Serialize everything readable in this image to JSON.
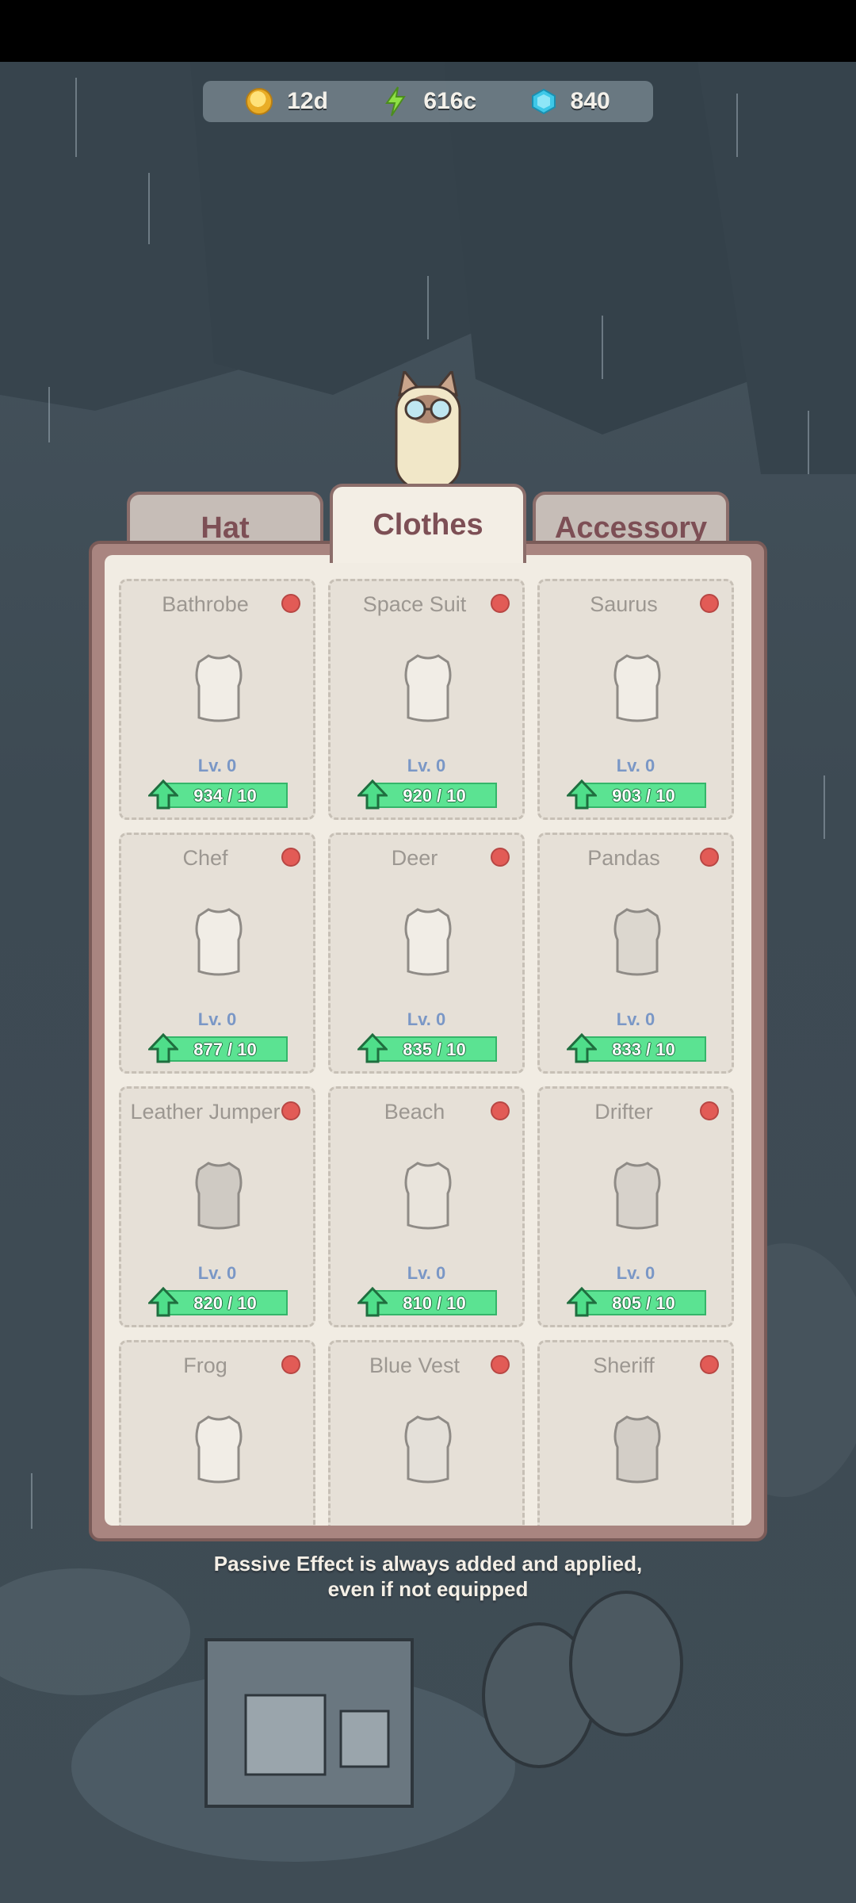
{
  "currency": {
    "coins": "12d",
    "energy": "616c",
    "gems": "840"
  },
  "tabs": [
    {
      "label": "Hat",
      "active": false
    },
    {
      "label": "Clothes",
      "active": true
    },
    {
      "label": "Accessory",
      "active": false
    }
  ],
  "items": [
    {
      "name": "Bathrobe",
      "level": "Lv. 0",
      "progress": "934 / 10",
      "icon": "bathrobe-icon",
      "shade": "#f1ede6"
    },
    {
      "name": "Space Suit",
      "level": "Lv. 0",
      "progress": "920 / 10",
      "icon": "space-suit-icon",
      "shade": "#f1ede6"
    },
    {
      "name": "Saurus",
      "level": "Lv. 0",
      "progress": "903 / 10",
      "icon": "saurus-vest-icon",
      "shade": "#f1ede6"
    },
    {
      "name": "Chef",
      "level": "Lv. 0",
      "progress": "877 / 10",
      "icon": "chef-coat-icon",
      "shade": "#f1ede6"
    },
    {
      "name": "Deer",
      "level": "Lv. 0",
      "progress": "835 / 10",
      "icon": "deer-vest-icon",
      "shade": "#f1ede6"
    },
    {
      "name": "Pandas",
      "level": "Lv. 0",
      "progress": "833 / 10",
      "icon": "pandas-vest-icon",
      "shade": "#dcd7cf"
    },
    {
      "name": "Leather Jumper",
      "level": "Lv. 0",
      "progress": "820 / 10",
      "icon": "leather-jumper-icon",
      "shade": "#cfcac3"
    },
    {
      "name": "Beach",
      "level": "Lv. 0",
      "progress": "810 / 10",
      "icon": "beach-shirt-icon",
      "shade": "#e9e4dc"
    },
    {
      "name": "Drifter",
      "level": "Lv. 0",
      "progress": "805 / 10",
      "icon": "drifter-vest-icon",
      "shade": "#d7d2cb"
    },
    {
      "name": "Frog",
      "level": "",
      "progress": "",
      "icon": "frog-vest-icon",
      "shade": "#f1ede6"
    },
    {
      "name": "Blue Vest",
      "level": "",
      "progress": "",
      "icon": "blue-vest-icon",
      "shade": "#e4e0d9"
    },
    {
      "name": "Sheriff",
      "level": "",
      "progress": "",
      "icon": "sheriff-vest-icon",
      "shade": "#d3cec7"
    }
  ],
  "note": {
    "line1": "Passive Effect is always added and applied,",
    "line2": "even if not equipped"
  },
  "colors": {
    "accent_tab_text": "#7d4f55",
    "progress_green": "#4fde8a",
    "badge_red": "#e25b56"
  }
}
